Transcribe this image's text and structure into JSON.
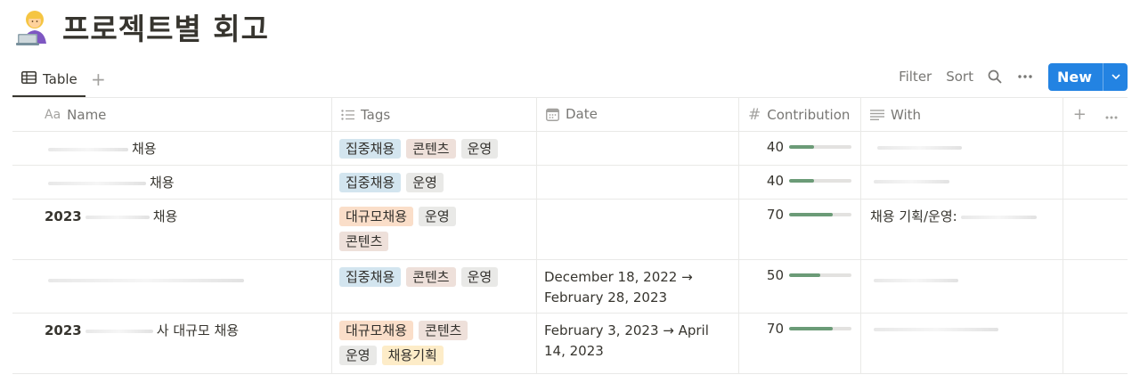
{
  "page": {
    "title": "프로젝트별 회고",
    "icon": "woman-technologist-emoji"
  },
  "view": {
    "tab_label": "Table",
    "add_view_icon": "plus-icon"
  },
  "toolbar": {
    "filter_label": "Filter",
    "sort_label": "Sort",
    "new_label": "New"
  },
  "columns": [
    {
      "label": "Name",
      "icon_text": "Aa"
    },
    {
      "label": "Tags",
      "icon": "list-icon"
    },
    {
      "label": "Date",
      "icon": "calendar-icon"
    },
    {
      "label": "Contribution",
      "icon_text": "#"
    },
    {
      "label": "With",
      "icon": "text-lines-icon"
    }
  ],
  "colors": {
    "accent": "#2383e2",
    "progress": "#6b9b77",
    "tag_blue": "#d3e5ef",
    "tag_brown": "#eee0da",
    "tag_gray": "#e9e9e7",
    "tag_orange": "#fadec9",
    "tag_yellow": "#fdecc8"
  },
  "rows": [
    {
      "name_prefix": "",
      "name_suffix": "채용",
      "tags": [
        {
          "label": "집중채용",
          "color": "#d3e5ef"
        },
        {
          "label": "콘텐츠",
          "color": "#eee0da"
        },
        {
          "label": "운영",
          "color": "#e9e9e7"
        }
      ],
      "date": "",
      "contribution": 40,
      "with": ""
    },
    {
      "name_prefix": "",
      "name_suffix": "채용",
      "tags": [
        {
          "label": "집중채용",
          "color": "#d3e5ef"
        },
        {
          "label": "운영",
          "color": "#e9e9e7"
        }
      ],
      "date": "",
      "contribution": 40,
      "with": ""
    },
    {
      "name_prefix": "2023",
      "name_suffix": "채용",
      "tags": [
        {
          "label": "대규모채용",
          "color": "#fadec9"
        },
        {
          "label": "운영",
          "color": "#e9e9e7"
        },
        {
          "label": "콘텐츠",
          "color": "#eee0da"
        }
      ],
      "date": "",
      "contribution": 70,
      "with": "채용 기획/운영:"
    },
    {
      "name_prefix": "",
      "name_suffix": "",
      "tags": [
        {
          "label": "집중채용",
          "color": "#d3e5ef"
        },
        {
          "label": "콘텐츠",
          "color": "#eee0da"
        },
        {
          "label": "운영",
          "color": "#e9e9e7"
        }
      ],
      "date": "December 18, 2022 → February 28, 2023",
      "contribution": 50,
      "with": ""
    },
    {
      "name_prefix": "2023",
      "name_suffix": "사 대규모 채용",
      "tags": [
        {
          "label": "대규모채용",
          "color": "#fadec9"
        },
        {
          "label": "콘텐츠",
          "color": "#eee0da"
        },
        {
          "label": "운영",
          "color": "#e9e9e7"
        },
        {
          "label": "채용기획",
          "color": "#fdecc8"
        }
      ],
      "date": "February 3, 2023 → April 14, 2023",
      "contribution": 70,
      "with": ""
    }
  ]
}
